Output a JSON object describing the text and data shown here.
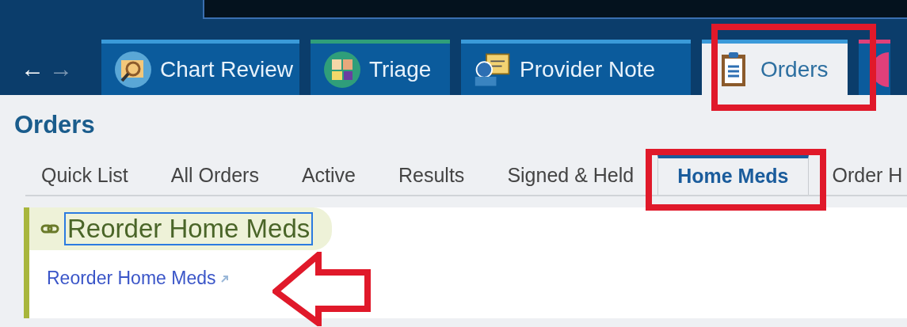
{
  "nav": {
    "back": {
      "label": "←",
      "disabled": false
    },
    "forward": {
      "label": "→",
      "disabled": true
    }
  },
  "activity_tabs": [
    {
      "label": "Chart Review",
      "kind": "magnifier",
      "selected": false,
      "color": "#3a9ad9"
    },
    {
      "label": "Triage",
      "kind": "grid",
      "selected": false,
      "color": "#2f9e7a"
    },
    {
      "label": "Provider Note",
      "kind": "note",
      "selected": false,
      "color": "#3a9ad9"
    },
    {
      "label": "Orders",
      "kind": "clipboard",
      "selected": true,
      "color": "#3a9ad9"
    },
    {
      "kind": "partial",
      "selected": false,
      "color": "#e0407a"
    }
  ],
  "page_title": "Orders",
  "sub_tabs": [
    {
      "label": "Quick List",
      "selected": false
    },
    {
      "label": "All Orders",
      "selected": false
    },
    {
      "label": "Active",
      "selected": false
    },
    {
      "label": "Results",
      "selected": false
    },
    {
      "label": "Signed & Held",
      "selected": false
    },
    {
      "label": "Home Meds",
      "selected": true
    },
    {
      "label": "Order H",
      "selected": false
    }
  ],
  "section": {
    "title": "Reorder Home Meds",
    "link": "Reorder Home Meds"
  }
}
